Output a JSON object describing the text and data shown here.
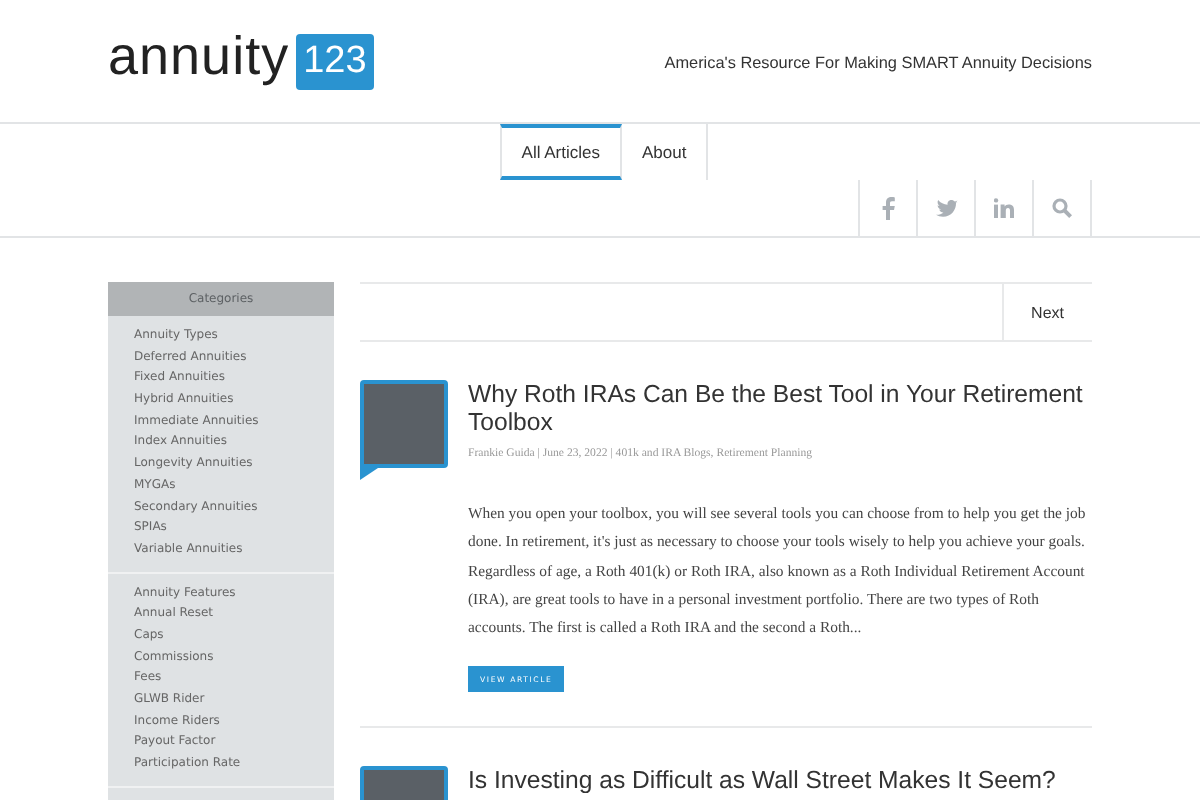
{
  "logo": {
    "wordmark": "annuity",
    "badge": "123"
  },
  "tagline": "America's Resource For Making SMART Annuity Decisions",
  "nav": [
    {
      "label": "All Articles",
      "selected": true
    },
    {
      "label": "About",
      "selected": false
    }
  ],
  "social": [
    {
      "kind": "facebook"
    },
    {
      "kind": "twitter"
    },
    {
      "kind": "linkedin"
    },
    {
      "kind": "search"
    }
  ],
  "sidebar": {
    "title": "Categories",
    "groups": [
      [
        "Annuity Types",
        "Deferred Annuities",
        "Fixed Annuities",
        "Hybrid Annuities",
        "Immediate Annuities",
        "Index Annuities",
        "Longevity Annuities",
        "MYGAs",
        "Secondary Annuities",
        "SPIAs",
        "Variable Annuities"
      ],
      [
        "Annuity Features",
        "Annual Reset",
        "Caps",
        "Commissions",
        "Fees",
        "GLWB Rider",
        "Income Riders",
        "Payout Factor",
        "Participation Rate"
      ]
    ]
  },
  "pager": {
    "next": "Next"
  },
  "articles": [
    {
      "title": "Why Roth IRAs Can Be the Best Tool in Your Retirement Toolbox",
      "meta": "Frankie Guida | June 23, 2022 | 401k and IRA Blogs, Retirement Planning",
      "excerpt": "When you open your toolbox, you will see several tools you can choose from to help you get the job done. In retirement, it's just as necessary to choose your tools wisely to help you achieve your goals. Regardless of age, a Roth 401(k) or Roth IRA, also known as a Roth Individual Retirement Account (IRA), are great tools to have in a personal investment portfolio. There are two types of Roth accounts. The first is called a Roth IRA and the second a Roth...",
      "button": "VIEW ARTICLE"
    },
    {
      "title": "Is Investing as Difficult as Wall Street Makes It Seem?"
    }
  ]
}
